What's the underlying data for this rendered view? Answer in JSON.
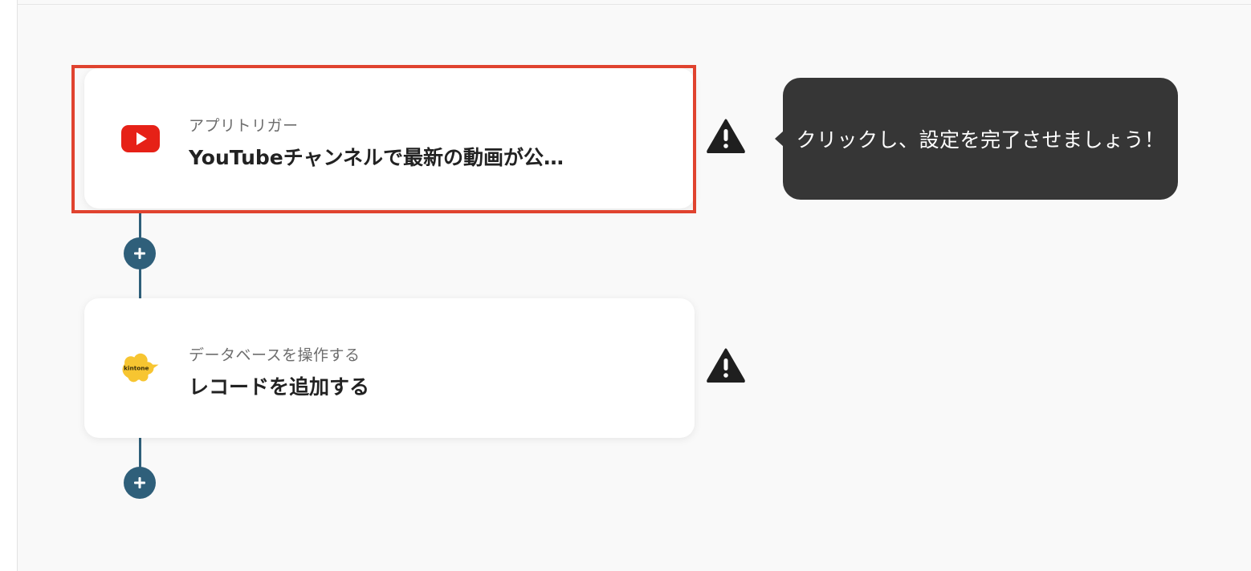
{
  "flow": {
    "steps": [
      {
        "category": "アプリトリガー",
        "title": "YouTubeチャンネルで最新の動画が公…",
        "app_icon": "youtube-logo-icon",
        "status_icon": "warning-icon",
        "highlighted": true
      },
      {
        "category": "データベースを操作する",
        "title": "レコードを追加する",
        "app_icon": "kintone-logo-icon",
        "logo_text": "kintone",
        "status_icon": "warning-icon",
        "highlighted": false
      }
    ],
    "add_step_icon": "plus-icon"
  },
  "tooltip": {
    "text": "クリックし、設定を完了させましょう！"
  },
  "colors": {
    "connector": "#2f5f7a",
    "highlight": "#e0432f",
    "youtube_red": "#e62117",
    "kintone_yellow": "#f7c531",
    "tooltip_bg": "#363636",
    "warning": "#1f1f1f"
  }
}
